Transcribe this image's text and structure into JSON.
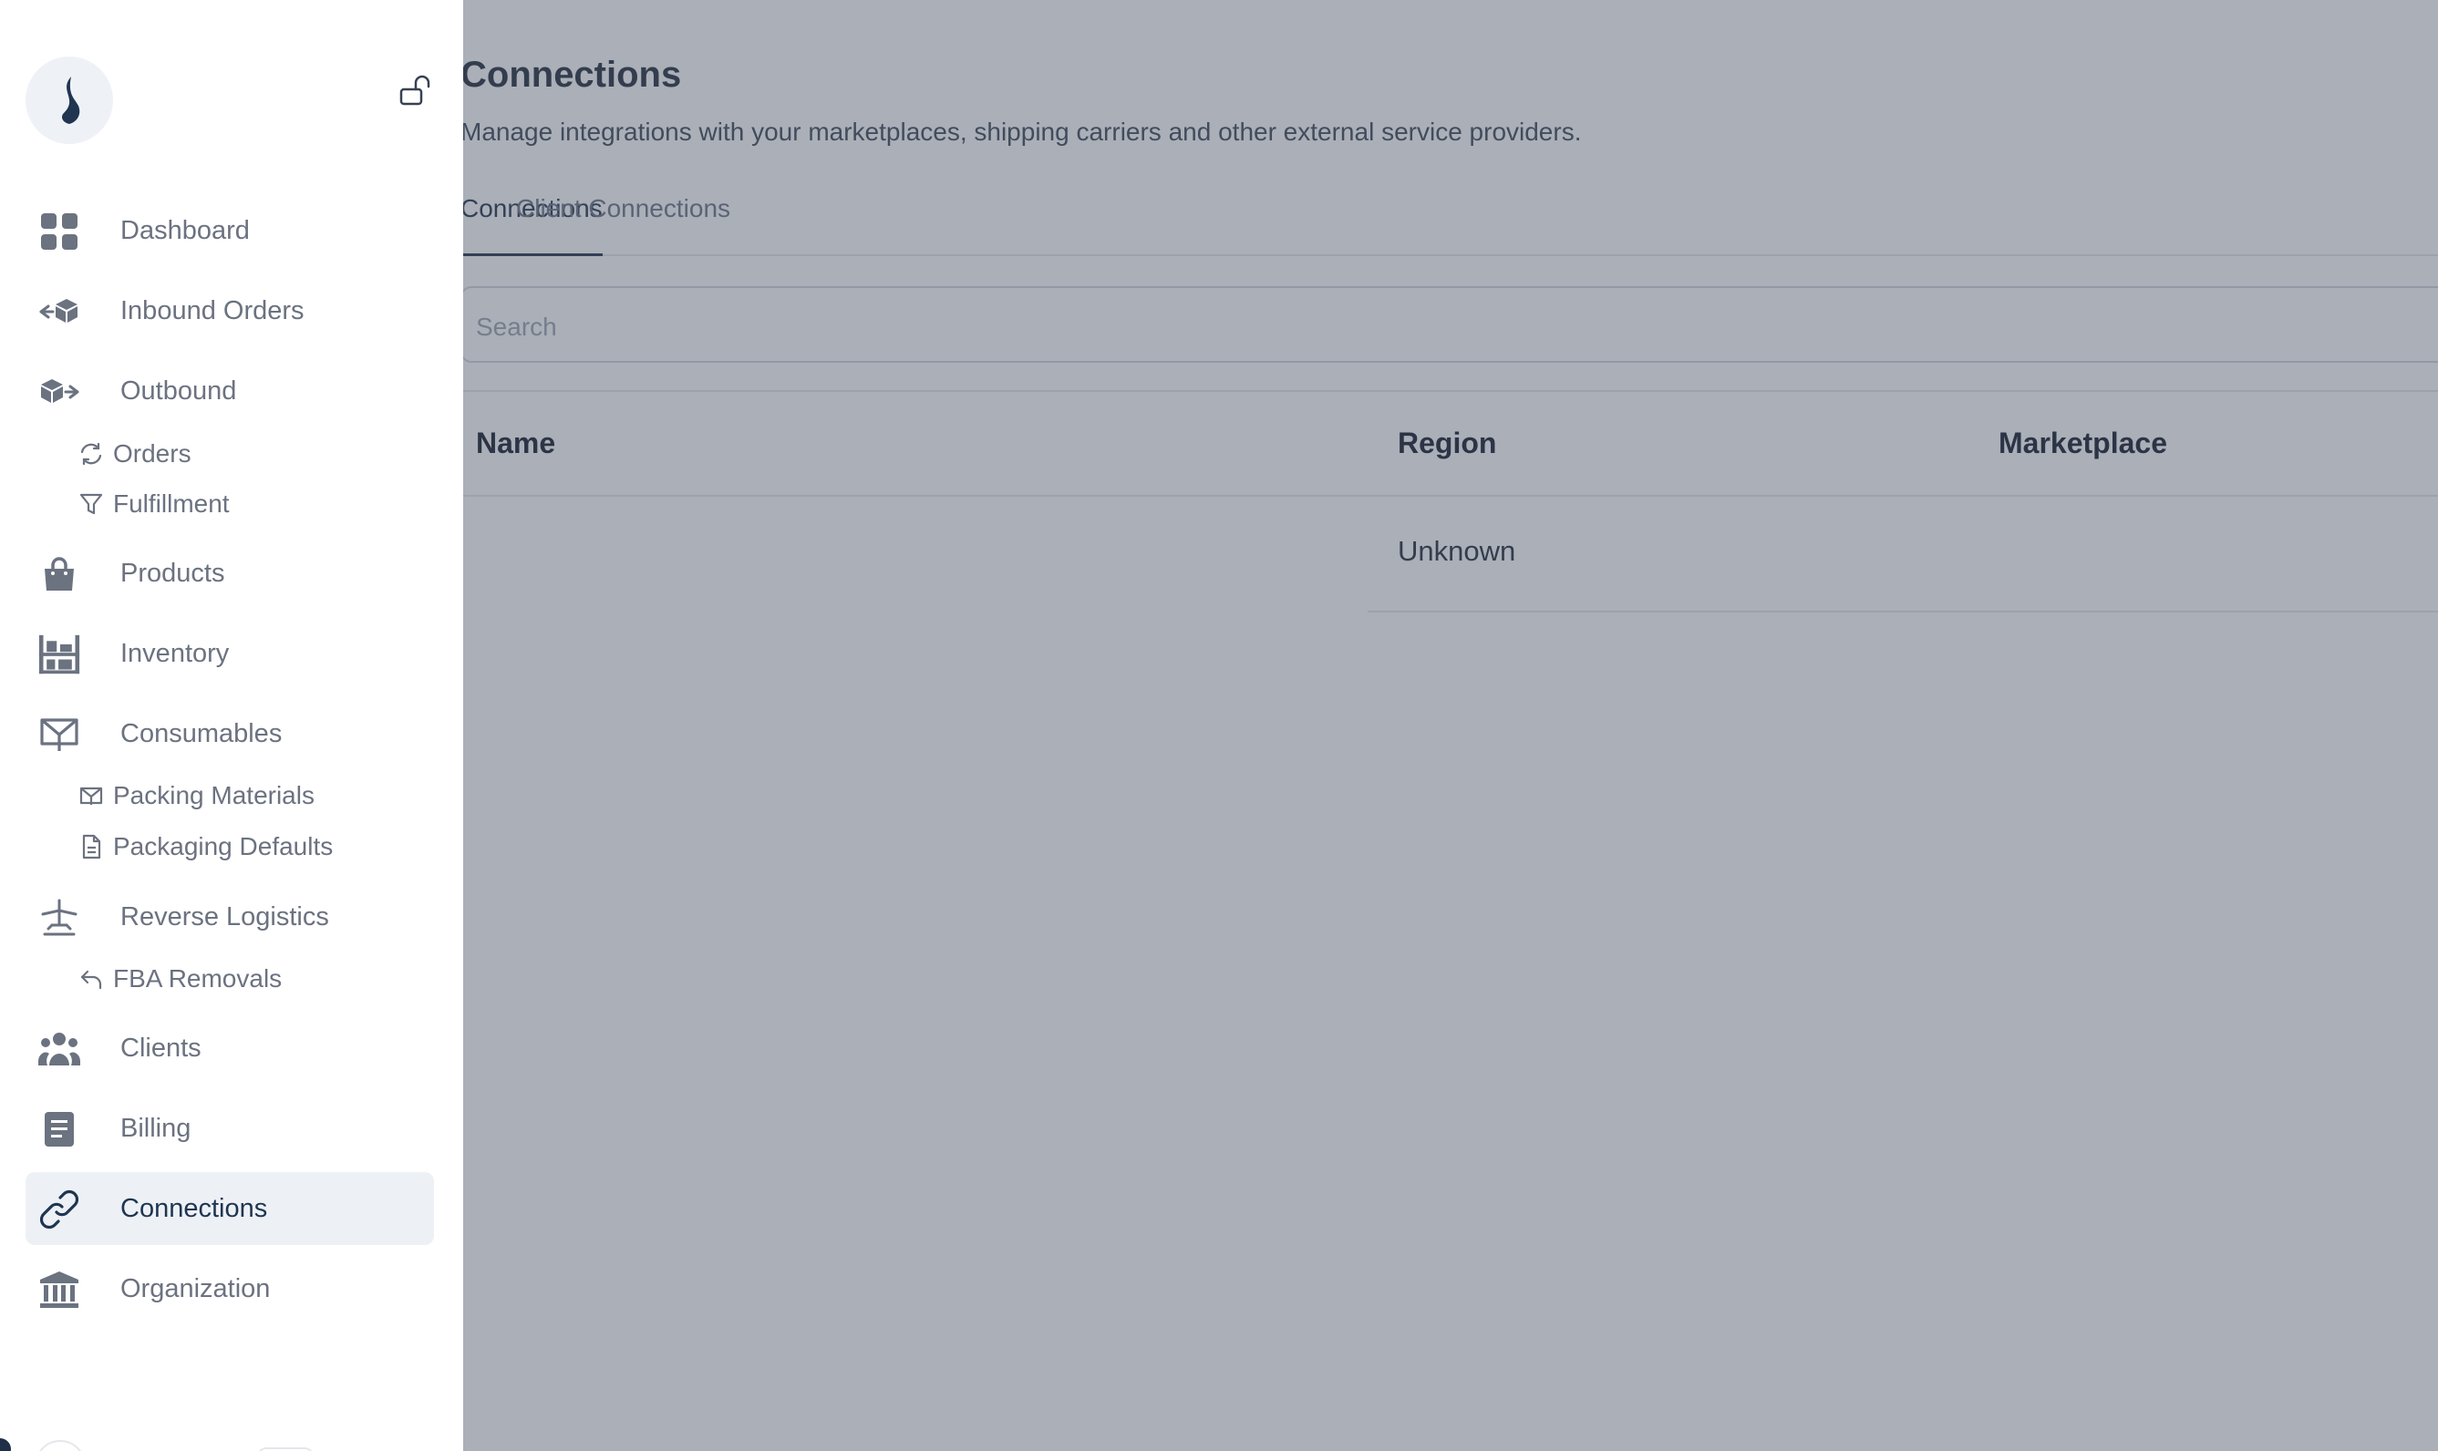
{
  "main": {
    "title": "Connections",
    "subtitle": "Manage integrations with your marketplaces, shipping carriers and other external service providers.",
    "tabs": [
      {
        "label": "Connections"
      },
      {
        "label": "Client Connections"
      }
    ],
    "search": {
      "placeholder": "Search"
    },
    "table": {
      "columns": [
        "Name",
        "Region",
        "Marketplace"
      ],
      "rows": [
        {
          "name": "",
          "region": "Unknown",
          "marketplace": ""
        }
      ]
    }
  },
  "sidebar": {
    "nav": {
      "dashboard": "Dashboard",
      "inbound_orders": "Inbound Orders",
      "outbound": "Outbound",
      "outbound_orders": "Orders",
      "fulfillment": "Fulfillment",
      "products": "Products",
      "inventory": "Inventory",
      "consumables": "Consumables",
      "packing_materials": "Packing Materials",
      "packaging_defaults": "Packaging Defaults",
      "reverse_logistics": "Reverse Logistics",
      "fba_removals": "FBA Removals",
      "clients": "Clients",
      "billing": "Billing",
      "connections": "Connections",
      "organization": "Organization"
    },
    "active_item": "Connections"
  },
  "colors": {
    "accent": "#1f3550",
    "icon": "#6b7280",
    "active_bg": "#edf1f6",
    "overlay": "#4b5569"
  }
}
